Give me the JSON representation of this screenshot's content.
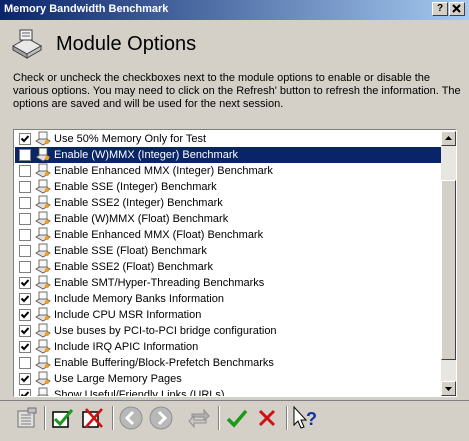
{
  "window": {
    "title": "Memory Bandwidth Benchmark",
    "help_btn": "?",
    "close_btn": "X"
  },
  "header": {
    "title": "Module Options",
    "icon": "module-icon"
  },
  "description": [
    "Check or uncheck the checkboxes next to the module options to enable or disable the",
    "various options. You may need to click on the Refresh' button to refresh the information. The",
    "options are saved and will be used for the next session."
  ],
  "options": [
    {
      "label": "Use 50% Memory Only for Test",
      "checked": true,
      "selected": false
    },
    {
      "label": "Enable (W)MMX (Integer) Benchmark",
      "checked": false,
      "selected": true
    },
    {
      "label": "Enable Enhanced MMX (Integer) Benchmark",
      "checked": false,
      "selected": false
    },
    {
      "label": "Enable SSE (Integer) Benchmark",
      "checked": false,
      "selected": false
    },
    {
      "label": "Enable SSE2 (Integer) Benchmark",
      "checked": false,
      "selected": false
    },
    {
      "label": "Enable (W)MMX (Float) Benchmark",
      "checked": false,
      "selected": false
    },
    {
      "label": "Enable Enhanced MMX (Float) Benchmark",
      "checked": false,
      "selected": false
    },
    {
      "label": "Enable SSE (Float) Benchmark",
      "checked": false,
      "selected": false
    },
    {
      "label": "Enable SSE2 (Float) Benchmark",
      "checked": false,
      "selected": false
    },
    {
      "label": "Enable SMT/Hyper-Threading Benchmarks",
      "checked": true,
      "selected": false
    },
    {
      "label": "Include Memory Banks Information",
      "checked": true,
      "selected": false
    },
    {
      "label": "Include CPU MSR Information",
      "checked": true,
      "selected": false
    },
    {
      "label": "Use buses by PCI-to-PCI bridge configuration",
      "checked": true,
      "selected": false
    },
    {
      "label": "Include IRQ APIC Information",
      "checked": true,
      "selected": false
    },
    {
      "label": "Enable Buffering/Block-Prefetch Benchmarks",
      "checked": false,
      "selected": false
    },
    {
      "label": "Use Large Memory Pages",
      "checked": true,
      "selected": false
    },
    {
      "label": "Show Useful/Friendly Links (URLs)",
      "checked": true,
      "selected": false
    }
  ],
  "toolbar": [
    "properties-icon",
    "check-all-icon",
    "uncheck-all-icon",
    "back-icon",
    "forward-icon",
    "refresh-icon",
    "ok-icon",
    "cancel-icon",
    "help-pointer-icon"
  ],
  "colors": {
    "selection": "#0a246a",
    "face": "#d4d0c8",
    "ok": "#1a9a1a",
    "cancel": "#d01010"
  }
}
